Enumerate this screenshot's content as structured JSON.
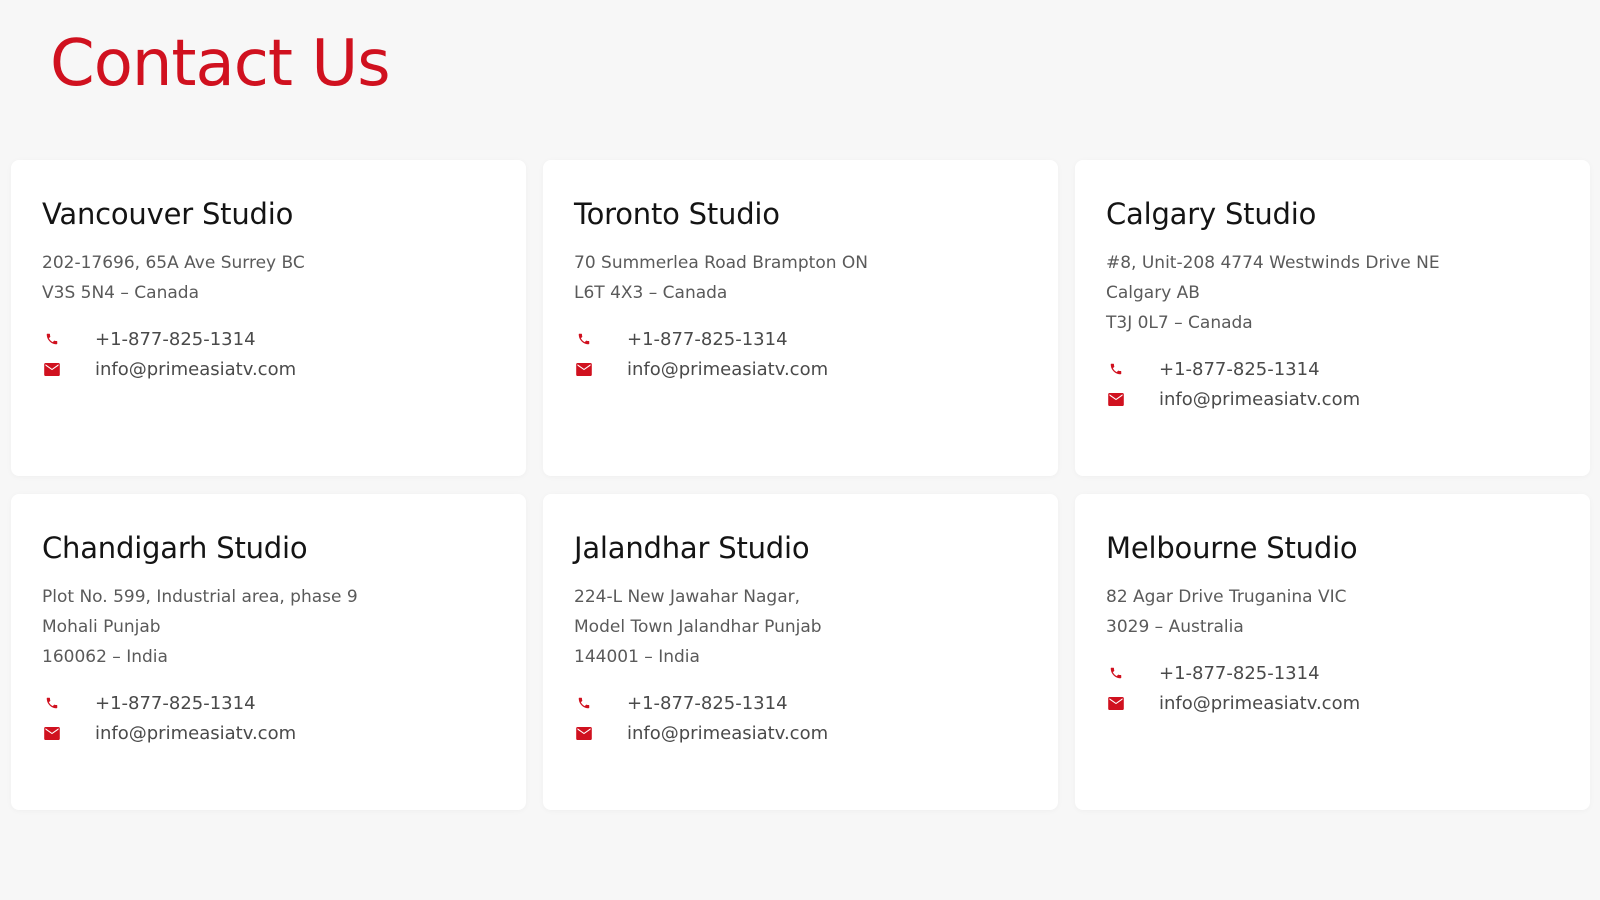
{
  "page": {
    "title": "Contact Us"
  },
  "colors": {
    "accent": "#d0111f",
    "background": "#f7f7f7",
    "card": "#ffffff",
    "heading": "#141414",
    "body_text": "#5a5a5a"
  },
  "icons": {
    "phone": "phone-icon",
    "email": "email-icon"
  },
  "studios": [
    {
      "name": "Vancouver Studio",
      "address": [
        "202-17696, 65A Ave Surrey BC",
        "V3S 5N4 – Canada"
      ],
      "phone": "+1-877-825-1314",
      "email": "info@primeasiatv.com"
    },
    {
      "name": "Toronto Studio",
      "address": [
        "70 Summerlea Road Brampton ON",
        "L6T 4X3 – Canada"
      ],
      "phone": "+1-877-825-1314",
      "email": "info@primeasiatv.com"
    },
    {
      "name": "Calgary Studio",
      "address": [
        "#8, Unit-208 4774 Westwinds Drive NE",
        "Calgary AB",
        "T3J 0L7 – Canada"
      ],
      "phone": "+1-877-825-1314",
      "email": "info@primeasiatv.com"
    },
    {
      "name": "Chandigarh Studio",
      "address": [
        "Plot No. 599, Industrial area, phase 9",
        "Mohali Punjab",
        "160062 – India"
      ],
      "phone": "+1-877-825-1314",
      "email": "info@primeasiatv.com"
    },
    {
      "name": "Jalandhar Studio",
      "address": [
        "224-L New Jawahar Nagar,",
        "Model Town Jalandhar Punjab",
        "144001 – India"
      ],
      "phone": "+1-877-825-1314",
      "email": "info@primeasiatv.com"
    },
    {
      "name": "Melbourne Studio",
      "address": [
        "82 Agar Drive Truganina VIC",
        "3029 – Australia"
      ],
      "phone": "+1-877-825-1314",
      "email": "info@primeasiatv.com"
    }
  ]
}
